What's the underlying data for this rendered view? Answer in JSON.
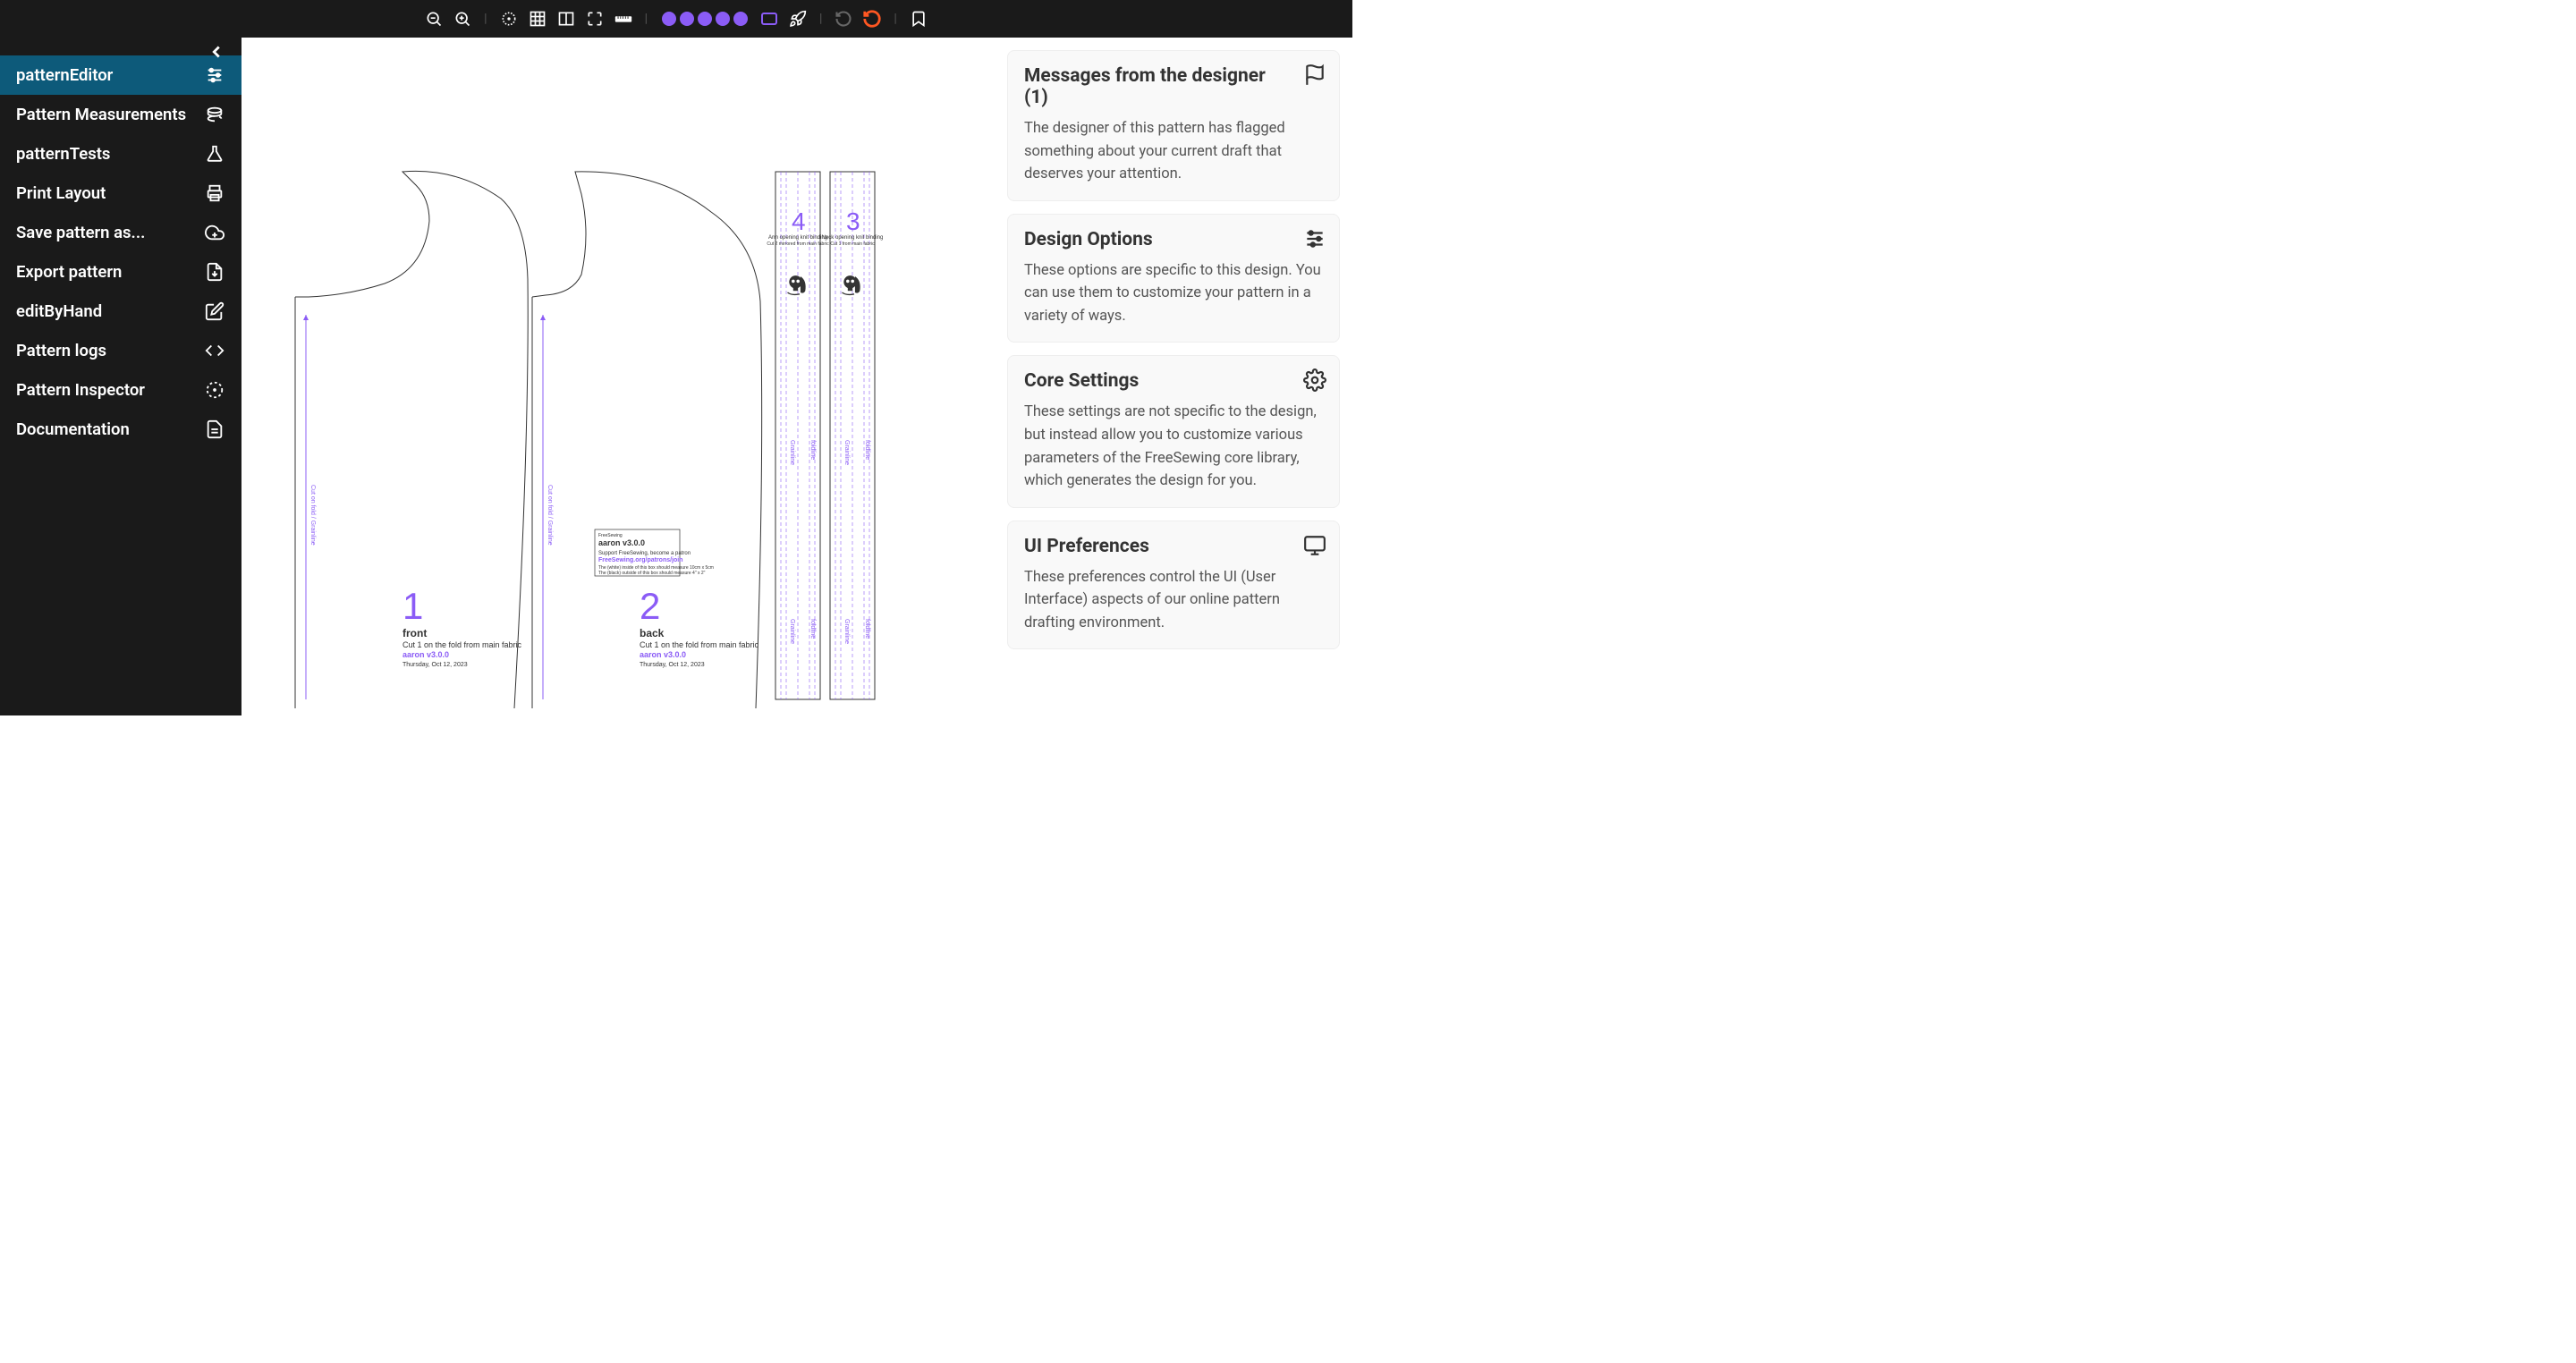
{
  "toolbar": {
    "items": [
      "zoom-out",
      "zoom-in",
      "sep",
      "target",
      "grid",
      "split",
      "expand",
      "ruler",
      "sep",
      "dots",
      "rect",
      "rocket",
      "sep",
      "undo-grey",
      "undo-orange",
      "sep",
      "bookmark"
    ]
  },
  "sidebar": {
    "items": [
      {
        "label": "patternEditor",
        "icon": "sliders",
        "active": true
      },
      {
        "label": "Pattern Measurements",
        "icon": "spool"
      },
      {
        "label": "patternTests",
        "icon": "flask"
      },
      {
        "label": "Print Layout",
        "icon": "printer"
      },
      {
        "label": "Save pattern as...",
        "icon": "cloud"
      },
      {
        "label": "Export pattern",
        "icon": "download"
      },
      {
        "label": "editByHand",
        "icon": "edit"
      },
      {
        "label": "Pattern logs",
        "icon": "code"
      },
      {
        "label": "Pattern Inspector",
        "icon": "focus"
      },
      {
        "label": "Documentation",
        "icon": "doc"
      }
    ]
  },
  "pattern": {
    "pieces": [
      {
        "num": "1",
        "name": "front",
        "cut": "Cut 1 on the fold from main fabric",
        "version": "aaron v3.0.0",
        "date": "Thursday, Oct 12, 2023",
        "grain": "Cut on fold / Grainline"
      },
      {
        "num": "2",
        "name": "back",
        "cut": "Cut 1 on the fold from main fabric",
        "version": "aaron v3.0.0",
        "date": "Thursday, Oct 12, 2023",
        "grain": "Cut on fold / Grainline"
      },
      {
        "num": "3",
        "name": "Neck opening knit binding",
        "cut": "Cut 1 from main fabric"
      },
      {
        "num": "4",
        "name": "Arm opening knit binding",
        "cut": "Cut 2 mirrored from main fabric"
      }
    ],
    "infobox": {
      "brand": "FreeSewing",
      "title": "aaron v3.0.0",
      "support": "Support FreeSewing, become a patron",
      "link": "FreeSewing.org/patrons/join",
      "note1": "The (white) inside of this box should measure 10cm x 5cm",
      "note2": "The (black) outside of this box should measure 4\" x 2\""
    }
  },
  "panels": [
    {
      "title": "Messages from the designer (1)",
      "body": "The designer of this pattern has flagged something about your current draft that deserves your attention.",
      "icon": "flag"
    },
    {
      "title": "Design Options",
      "body": "These options are specific to this design. You can use them to customize your pattern in a variety of ways.",
      "icon": "sliders"
    },
    {
      "title": "Core Settings",
      "body": "These settings are not specific to the design, but instead allow you to customize various parameters of the FreeSewing core library, which generates the design for you.",
      "icon": "gear"
    },
    {
      "title": "UI Preferences",
      "body": "These preferences control the UI (User Interface) aspects of our online pattern drafting environment.",
      "icon": "monitor"
    }
  ]
}
